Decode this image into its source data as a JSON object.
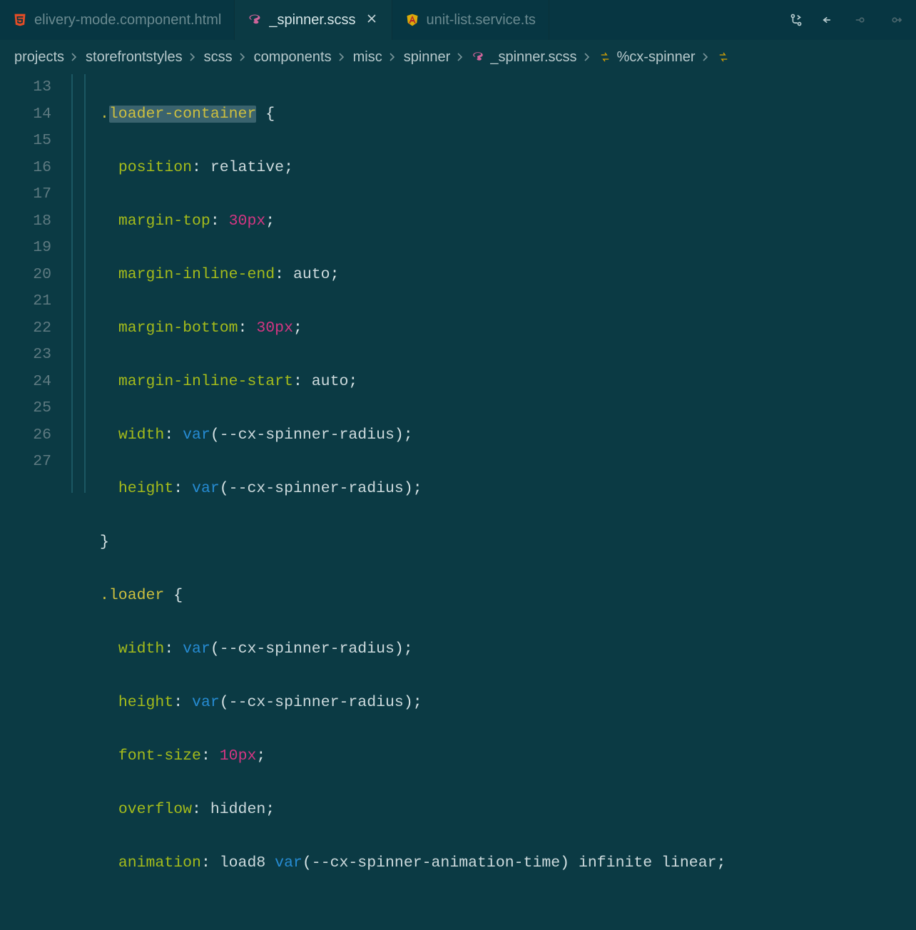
{
  "tabs": [
    {
      "label": "elivery-mode.component.html",
      "icon": "html5-icon",
      "active": false
    },
    {
      "label": "_spinner.scss",
      "icon": "sass-icon",
      "active": true
    },
    {
      "label": "unit-list.service.ts",
      "icon": "angular-icon",
      "active": false
    }
  ],
  "breadcrumb": [
    {
      "label": "projects"
    },
    {
      "label": "storefrontstyles"
    },
    {
      "label": "scss"
    },
    {
      "label": "components"
    },
    {
      "label": "misc"
    },
    {
      "label": "spinner"
    },
    {
      "label": "_spinner.scss",
      "icon": "sass-icon"
    },
    {
      "label": "%cx-spinner",
      "icon": "symbol-icon"
    },
    {
      "label": "",
      "icon": "symbol-icon"
    }
  ],
  "gutter": {
    "start": 13,
    "end": 27
  },
  "code": {
    "l13": {
      "sel": "loader-container",
      "brace": " {"
    },
    "l14": {
      "prop": "position",
      "val": "relative"
    },
    "l15": {
      "prop": "margin-top",
      "num": "30",
      "unit": "px"
    },
    "l16": {
      "prop": "margin-inline-end",
      "val": "auto"
    },
    "l17": {
      "prop": "margin-bottom",
      "num": "30",
      "unit": "px"
    },
    "l18": {
      "prop": "margin-inline-start",
      "val": "auto"
    },
    "l19": {
      "prop": "width",
      "func": "var",
      "arg": "--cx-spinner-radius"
    },
    "l20": {
      "prop": "height",
      "func": "var",
      "arg": "--cx-spinner-radius"
    },
    "l21": {
      "brace": "}"
    },
    "l22": {
      "sel": "loader",
      "brace": " {"
    },
    "l23": {
      "prop": "width",
      "func": "var",
      "arg": "--cx-spinner-radius"
    },
    "l24": {
      "prop": "height",
      "func": "var",
      "arg": "--cx-spinner-radius"
    },
    "l25": {
      "prop": "font-size",
      "num": "10",
      "unit": "px"
    },
    "l26": {
      "prop": "overflow",
      "val": "hidden"
    },
    "l27": {
      "prop": "animation",
      "val": "load8",
      "func": "var",
      "arg": "--cx-spinner-animation-time",
      "tail": " infinite linear"
    }
  }
}
